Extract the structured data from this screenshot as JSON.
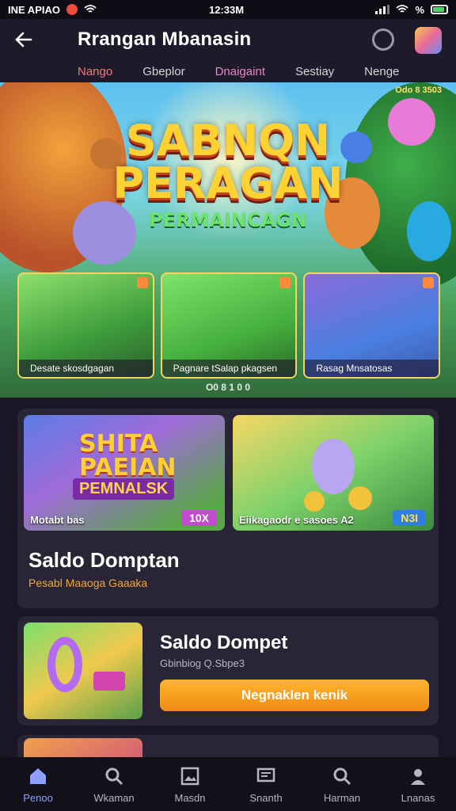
{
  "status_bar": {
    "carrier": "INE APIAO",
    "time": "12:33M",
    "battery_pct": "%"
  },
  "header": {
    "title": "Rrangan Mbanasin"
  },
  "tabs": [
    {
      "label": "Nango"
    },
    {
      "label": "Gbeplor"
    },
    {
      "label": "Dnaigaint"
    },
    {
      "label": "Sestiay"
    },
    {
      "label": "Nenge"
    }
  ],
  "hero": {
    "title_line1": "SABNQN",
    "title_line2": "PERAGAN",
    "title_line3": "PERMAINCAGN",
    "badge": "Odo 8 3503",
    "cards": [
      {
        "label": "Desate skosdgagan"
      },
      {
        "label": "Pagnare tSalap pkagsen"
      },
      {
        "label": "Rasag        Mnsatosas"
      }
    ],
    "pager": "O0 8 1 0 0"
  },
  "games": [
    {
      "title": "SHITA PAEIAN",
      "subtitle": "PEMNALSK",
      "label": "Motabt bas",
      "tag": "10X"
    },
    {
      "title": "",
      "subtitle": "",
      "label": "Eiikagaodr e sasoes A2",
      "tag": "N3I"
    }
  ],
  "wallet_panel": {
    "title": "Saldo Domptan",
    "subtitle": "Pesabl Maaoga Gaaaka"
  },
  "wallet_panel2": {
    "title": "Saldo Dompet",
    "subtitle": "Gbinbiog Q.Sbpe3",
    "button": "Negnaklen kenik"
  },
  "bottom_nav": [
    {
      "label": "Penoo",
      "icon": "home-icon",
      "active": true
    },
    {
      "label": "Wkaman",
      "icon": "search-icon",
      "active": false
    },
    {
      "label": "Masdn",
      "icon": "gallery-icon",
      "active": false
    },
    {
      "label": "Snanth",
      "icon": "message-icon",
      "active": false
    },
    {
      "label": "Harman",
      "icon": "search-icon",
      "active": false
    },
    {
      "label": "Lnanas",
      "icon": "profile-icon",
      "active": false
    }
  ],
  "colors": {
    "accent": "#f08a14",
    "active_nav": "#8fa0ff",
    "background": "#1a1626",
    "panel": "#2a2536"
  }
}
